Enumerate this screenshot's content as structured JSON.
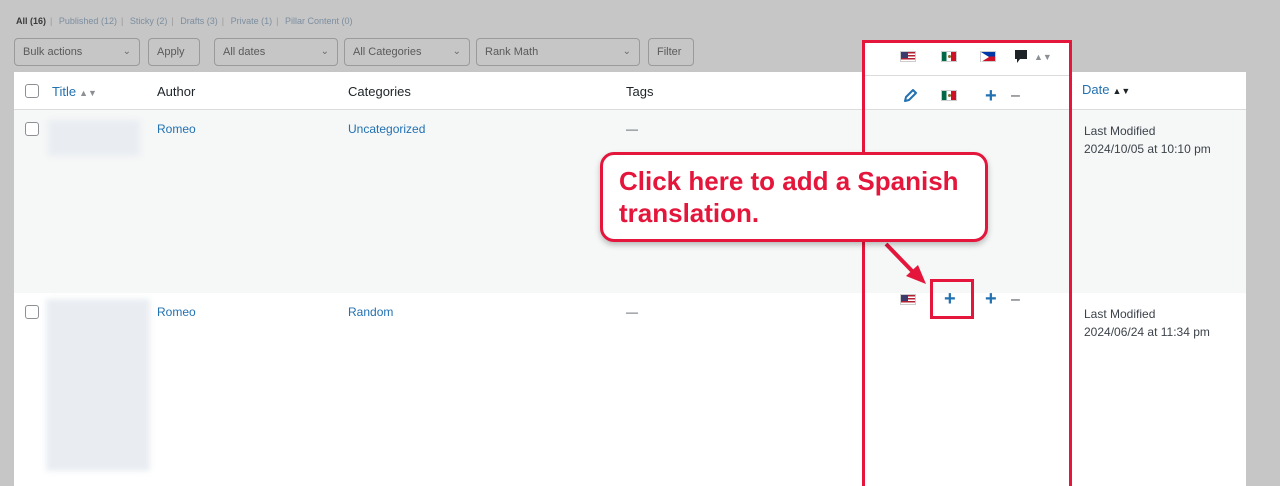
{
  "filters": {
    "all": "All",
    "all_count": "(16)",
    "published": "Published",
    "published_count": "(12)",
    "sticky": "Sticky",
    "sticky_count": "(2)",
    "drafts": "Drafts",
    "drafts_count": "(3)",
    "private": "Private",
    "private_count": "(1)",
    "pillar": "Pillar Content",
    "pillar_count": "(0)"
  },
  "toolbar": {
    "bulk_actions": "Bulk actions",
    "apply": "Apply",
    "all_dates": "All dates",
    "all_categories": "All Categories",
    "rank_math": "Rank Math",
    "filter": "Filter"
  },
  "columns": {
    "title": "Title",
    "author": "Author",
    "categories": "Categories",
    "tags": "Tags",
    "date": "Date"
  },
  "rows": [
    {
      "author": "Romeo",
      "category": "Uncategorized",
      "tags": "—",
      "date_status": "Last Modified",
      "date_value": "2024/10/05 at 10:10 pm"
    },
    {
      "author": "Romeo",
      "category": "Random",
      "tags": "—",
      "date_status": "Last Modified",
      "date_value": "2024/06/24 at 11:34 pm"
    }
  ],
  "icons": {
    "plus": "+",
    "minus": "–",
    "sort": "▲▼",
    "sort_active": "▲▼",
    "chev": "⌄"
  },
  "callout": {
    "line1": "Click here to add a Spanish",
    "line2": "translation."
  },
  "colors": {
    "annotation": "#e4163b",
    "link": "#2271b1"
  }
}
